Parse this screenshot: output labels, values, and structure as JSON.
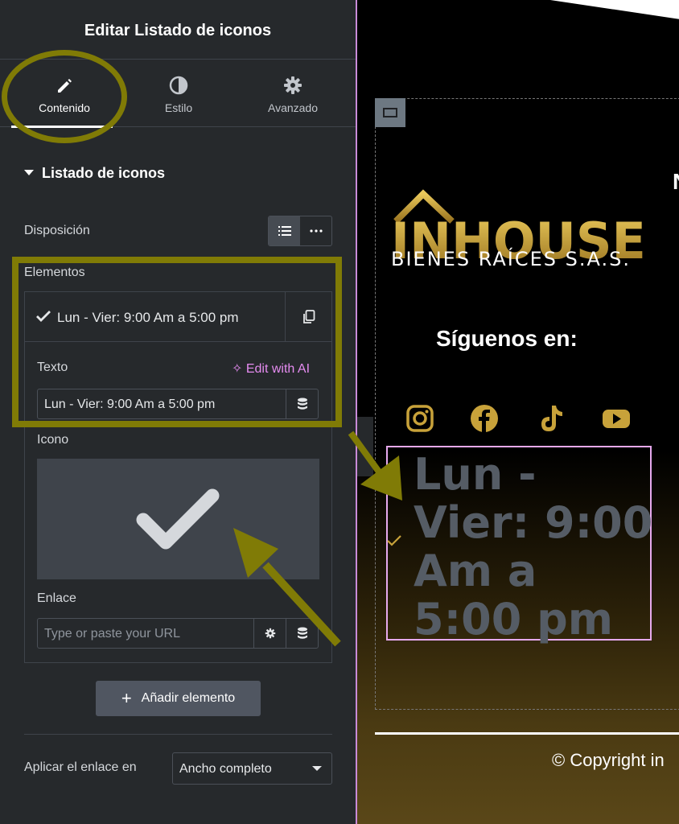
{
  "panel": {
    "title": "Editar Listado de iconos",
    "tabs": [
      {
        "label": "Contenido",
        "icon": "pencil-icon",
        "active": true
      },
      {
        "label": "Estilo",
        "icon": "contrast-icon",
        "active": false
      },
      {
        "label": "Avanzado",
        "icon": "gear-icon",
        "active": false
      }
    ],
    "section_title": "Listado de iconos",
    "layout_label": "Disposición",
    "items_label": "Elementos",
    "item": {
      "title": "Lun - Vier: 9:00 Am a 5:00 pm",
      "text_label": "Texto",
      "edit_ai": "Edit with AI",
      "text_value": "Lun - Vier: 9:00 Am a 5:00 pm",
      "icon_label": "Icono",
      "link_label": "Enlace",
      "link_placeholder": "Type or paste your URL"
    },
    "add_button": "Añadir elemento",
    "apply_link_label": "Aplicar el enlace en",
    "apply_link_value": "Ancho completo"
  },
  "preview": {
    "logo_main": "INHOUSE",
    "logo_sub": "BIENES RAÍCES S.A.S.",
    "follow": "Síguenos en:",
    "n_letter": "N",
    "hours": "Lun - Vier: 9:00 Am a 5:00 pm",
    "copyright": "© Copyright in",
    "social": [
      "instagram-icon",
      "facebook-icon",
      "tiktok-icon",
      "youtube-icon"
    ]
  },
  "colors": {
    "annotation": "#807b06",
    "gold": "#c8a23a",
    "ai_accent": "#e58cf0",
    "panel_bg": "#26292c"
  }
}
